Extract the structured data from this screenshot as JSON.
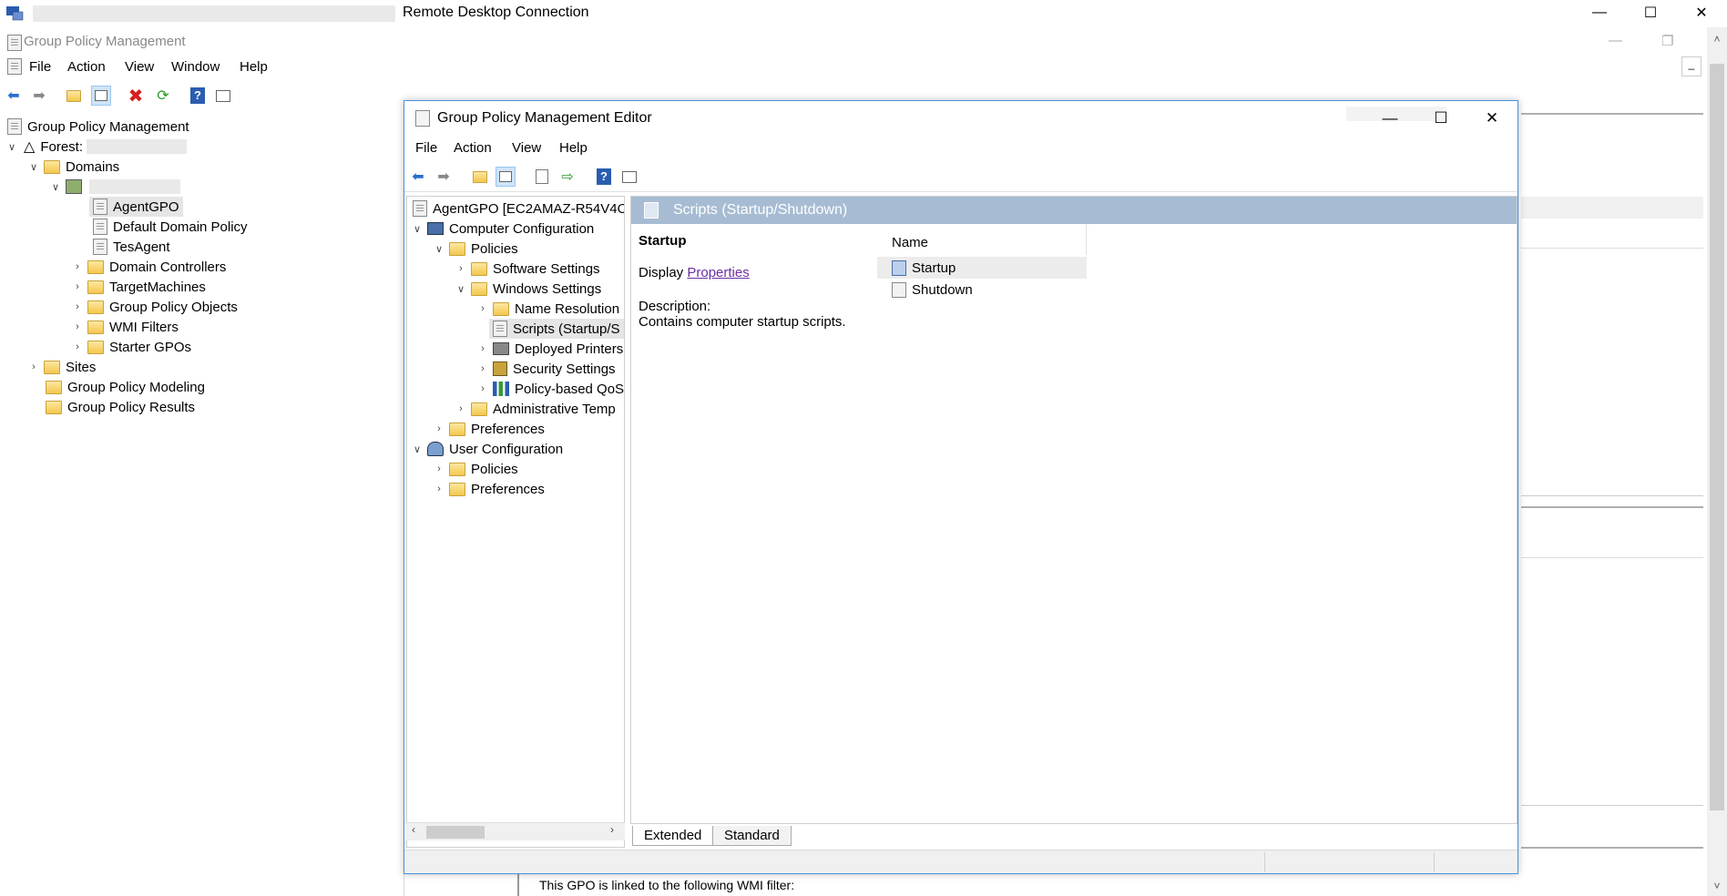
{
  "rdp": {
    "title": "Remote Desktop Connection"
  },
  "gpm": {
    "title": "Group Policy Management",
    "menu": [
      "File",
      "Action",
      "View",
      "Window",
      "Help"
    ],
    "tree": {
      "root": "Group Policy Management",
      "forest": "Forest:",
      "domains": "Domains",
      "items": [
        "AgentGPO",
        "Default Domain Policy",
        "TesAgent",
        "Domain Controllers",
        "TargetMachines",
        "Group Policy Objects",
        "WMI Filters",
        "Starter GPOs"
      ],
      "sites": "Sites",
      "modeling": "Group Policy Modeling",
      "results": "Group Policy Results"
    },
    "status_text": "This GPO is linked to the following WMI filter:"
  },
  "editor": {
    "title": "Group Policy Management Editor",
    "menu": [
      "File",
      "Action",
      "View",
      "Help"
    ],
    "tree": {
      "root": "AgentGPO [EC2AMAZ-R54V4O(",
      "computer_config": "Computer Configuration",
      "policies": "Policies",
      "software_settings": "Software Settings",
      "windows_settings": "Windows Settings",
      "name_resolution": "Name Resolution",
      "scripts": "Scripts (Startup/S",
      "deployed_printers": "Deployed Printers",
      "security_settings": "Security Settings",
      "policy_qos": "Policy-based QoS",
      "admin_templates": "Administrative Temp",
      "preferences": "Preferences",
      "user_config": "User Configuration",
      "user_policies": "Policies",
      "user_preferences": "Preferences"
    },
    "content": {
      "header": "Scripts (Startup/Shutdown)",
      "section_title": "Startup",
      "display_label": "Display",
      "properties_link": "Properties",
      "description_label": "Description:",
      "description_text": "Contains computer startup scripts.",
      "column_name": "Name",
      "items": [
        "Startup",
        "Shutdown"
      ]
    },
    "tabs": [
      "Extended",
      "Standard"
    ]
  }
}
